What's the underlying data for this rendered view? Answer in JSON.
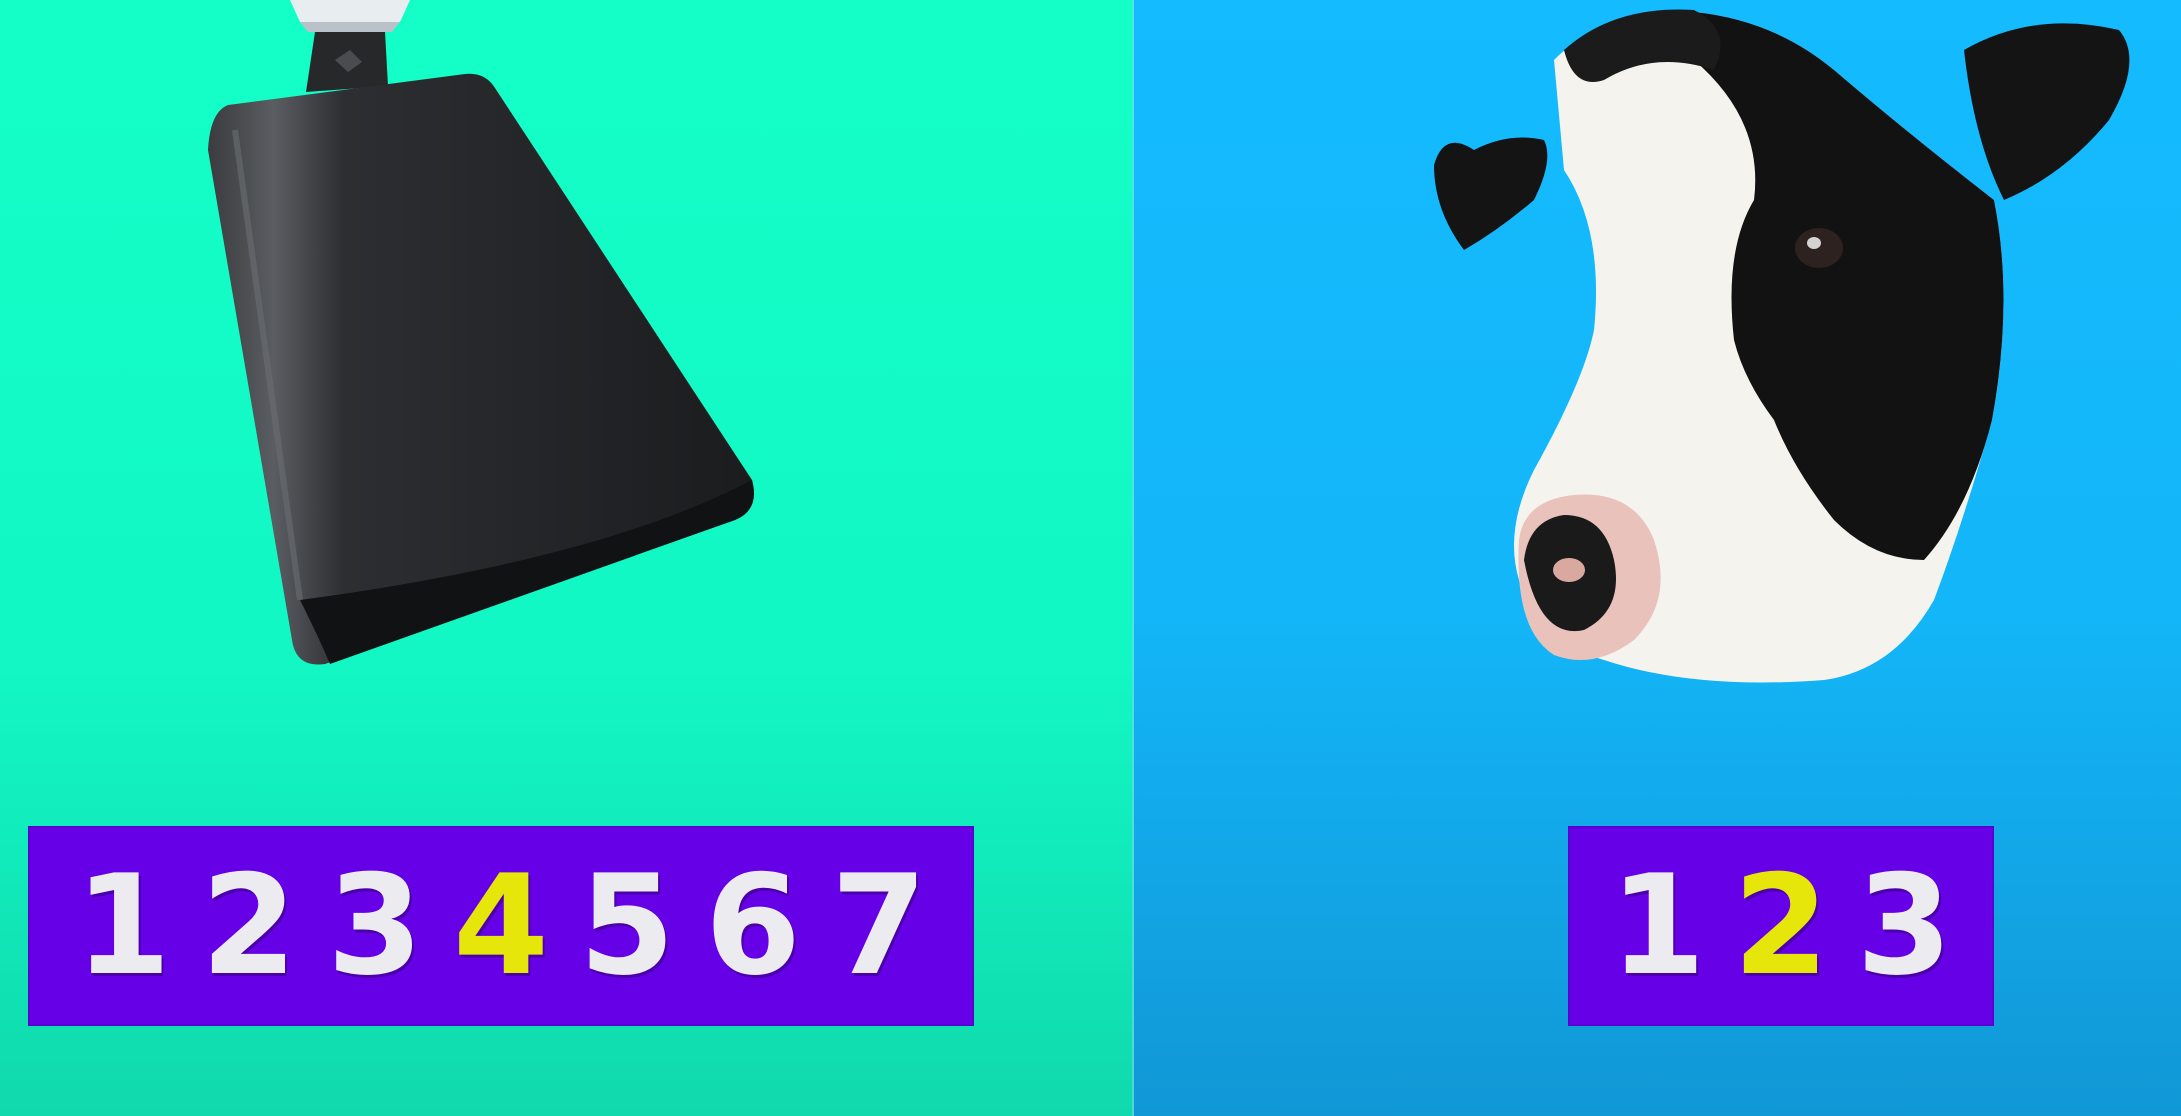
{
  "left": {
    "background": "#14ffc8",
    "image": "cowbell",
    "counter": {
      "digits": [
        "1",
        "2",
        "3",
        "4",
        "5",
        "6",
        "7"
      ],
      "highlight_index": 3
    }
  },
  "right": {
    "background": "#14bbff",
    "image": "cow-head",
    "counter": {
      "digits": [
        "1",
        "2",
        "3"
      ],
      "highlight_index": 1
    }
  },
  "colors": {
    "counter_bg": "#6600e6",
    "digit": "#ececf0",
    "highlight": "#e6e60a"
  }
}
